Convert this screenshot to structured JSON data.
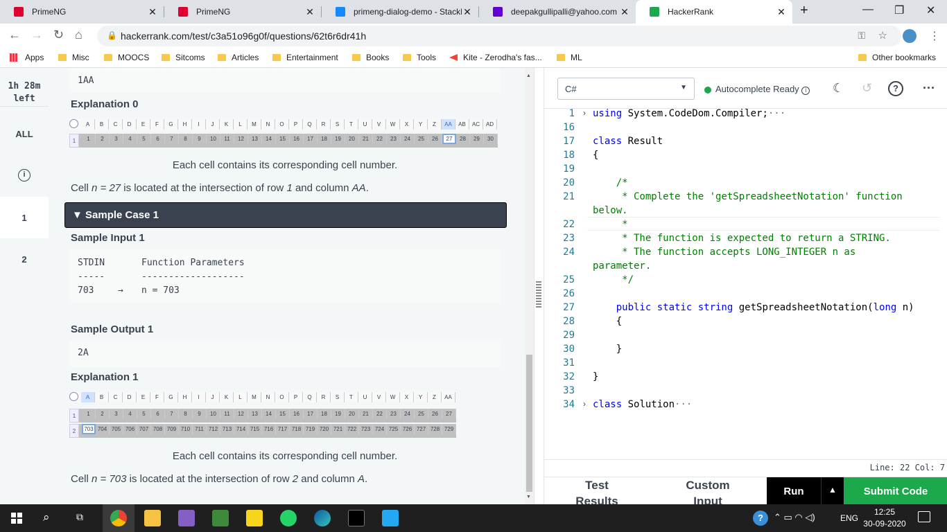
{
  "browser": {
    "tabs": [
      {
        "title": "PrimeNG",
        "icon": "primeng-icon",
        "color": "#dd0031"
      },
      {
        "title": "PrimeNG",
        "icon": "primeng-icon",
        "color": "#dd0031"
      },
      {
        "title": "primeng-dialog-demo - StackB",
        "icon": "stackblitz-icon",
        "color": "#1389fd"
      },
      {
        "title": "deepakgullipalli@yahoo.com -",
        "icon": "yahoo-mail-icon",
        "color": "#6001d2"
      },
      {
        "title": "HackerRank",
        "icon": "hackerrank-icon",
        "color": "#1ba94c"
      }
    ],
    "url": "hackerrank.com/test/c3a51o96g0f/questions/62t6r6dr41h",
    "bookmarks": [
      "Apps",
      "Misc",
      "MOOCS",
      "Sitcoms",
      "Articles",
      "Entertainment",
      "Books",
      "Tools",
      "Kite - Zerodha's fas...",
      "ML"
    ],
    "other_bookmarks": "Other bookmarks"
  },
  "sidebar": {
    "time_left": "1h 28m left",
    "items": [
      "ALL",
      "1",
      "2"
    ]
  },
  "problem": {
    "prev_output": "1AA",
    "explanation0_title": "Explanation 0",
    "sheet0_cols": [
      "A",
      "B",
      "C",
      "D",
      "E",
      "F",
      "G",
      "H",
      "I",
      "J",
      "K",
      "L",
      "M",
      "N",
      "O",
      "P",
      "Q",
      "R",
      "S",
      "T",
      "U",
      "V",
      "W",
      "X",
      "Y",
      "Z",
      "AA",
      "AB",
      "AC",
      "AD"
    ],
    "sheet0_row": [
      "1",
      "2",
      "3",
      "4",
      "5",
      "6",
      "7",
      "8",
      "9",
      "10",
      "11",
      "12",
      "13",
      "14",
      "15",
      "16",
      "17",
      "18",
      "19",
      "20",
      "21",
      "22",
      "23",
      "24",
      "25",
      "26",
      "27",
      "28",
      "29",
      "30"
    ],
    "caption0": "Each cell contains its corresponding cell number.",
    "desc0": {
      "pre": "Cell ",
      "n": "n = 27",
      "mid": " is located at the intersection of row ",
      "row": "1",
      "and": " and column ",
      "col": "AA",
      "end": "."
    },
    "sample_case_title": "Sample Case 1",
    "sample_input_title": "Sample Input 1",
    "input_header_left": "STDIN",
    "input_header_right": "Function Parameters",
    "input_rule_left": "-----",
    "input_rule_right": "-------------------",
    "input_value": "703",
    "input_arrow": "→",
    "input_param": "n = 703",
    "sample_output_title": "Sample Output 1",
    "sample_output": "2A",
    "explanation1_title": "Explanation 1",
    "sheet1_cols": [
      "A",
      "B",
      "C",
      "D",
      "E",
      "F",
      "G",
      "H",
      "I",
      "J",
      "K",
      "L",
      "M",
      "N",
      "O",
      "P",
      "Q",
      "R",
      "S",
      "T",
      "U",
      "V",
      "W",
      "X",
      "Y",
      "Z",
      "AA"
    ],
    "sheet1_row1": [
      "1",
      "2",
      "3",
      "4",
      "5",
      "6",
      "7",
      "8",
      "9",
      "10",
      "11",
      "12",
      "13",
      "14",
      "15",
      "16",
      "17",
      "18",
      "19",
      "20",
      "21",
      "22",
      "23",
      "24",
      "25",
      "26",
      "27"
    ],
    "sheet1_row2": [
      "703",
      "704",
      "705",
      "706",
      "707",
      "708",
      "709",
      "710",
      "711",
      "712",
      "713",
      "714",
      "715",
      "716",
      "717",
      "718",
      "719",
      "720",
      "721",
      "722",
      "723",
      "724",
      "725",
      "726",
      "727",
      "728",
      "729"
    ],
    "caption1": "Each cell contains its corresponding cell number.",
    "desc1": {
      "pre": "Cell ",
      "n": "n = 703",
      "mid": " is located at the intersection of row ",
      "row": "2",
      "and": " and column ",
      "col": "A",
      "end": "."
    }
  },
  "editor": {
    "language": "C#",
    "autocomplete": "Autocomplete Ready",
    "lines": [
      {
        "n": "1",
        "fold": "›",
        "text": "using System.CodeDom.Compiler;",
        "kind": "using",
        "tail": "···"
      },
      {
        "n": "16",
        "text": ""
      },
      {
        "n": "17",
        "text": "class Result",
        "kind": "class"
      },
      {
        "n": "18",
        "text": "{"
      },
      {
        "n": "19",
        "text": ""
      },
      {
        "n": "20",
        "text": "    /*",
        "kind": "comment"
      },
      {
        "n": "21",
        "text": "     * Complete the 'getSpreadsheetNotation' function",
        "kind": "comment"
      },
      {
        "n": "",
        "text": "below.",
        "kind": "comment"
      },
      {
        "n": "22",
        "text": "     *",
        "kind": "comment"
      },
      {
        "n": "23",
        "text": "     * The function is expected to return a STRING.",
        "kind": "comment"
      },
      {
        "n": "24",
        "text": "     * The function accepts LONG_INTEGER n as",
        "kind": "comment"
      },
      {
        "n": "",
        "text": "parameter.",
        "kind": "comment"
      },
      {
        "n": "25",
        "text": "     */",
        "kind": "comment"
      },
      {
        "n": "26",
        "text": ""
      },
      {
        "n": "27",
        "text": "    public static string getSpreadsheetNotation(long n)",
        "kind": "method"
      },
      {
        "n": "28",
        "text": "    {"
      },
      {
        "n": "29",
        "text": ""
      },
      {
        "n": "30",
        "text": "    }"
      },
      {
        "n": "31",
        "text": ""
      },
      {
        "n": "32",
        "text": "}"
      },
      {
        "n": "33",
        "text": ""
      },
      {
        "n": "34",
        "fold": "›",
        "text": "class Solution",
        "kind": "class",
        "tail": "···"
      }
    ],
    "status": "Line: 22 Col: 7",
    "test_results": "Test Results",
    "custom_input": "Custom Input",
    "run": "Run",
    "submit": "Submit Code"
  },
  "taskbar": {
    "lang": "ENG",
    "time": "12:25",
    "date": "30-09-2020"
  }
}
